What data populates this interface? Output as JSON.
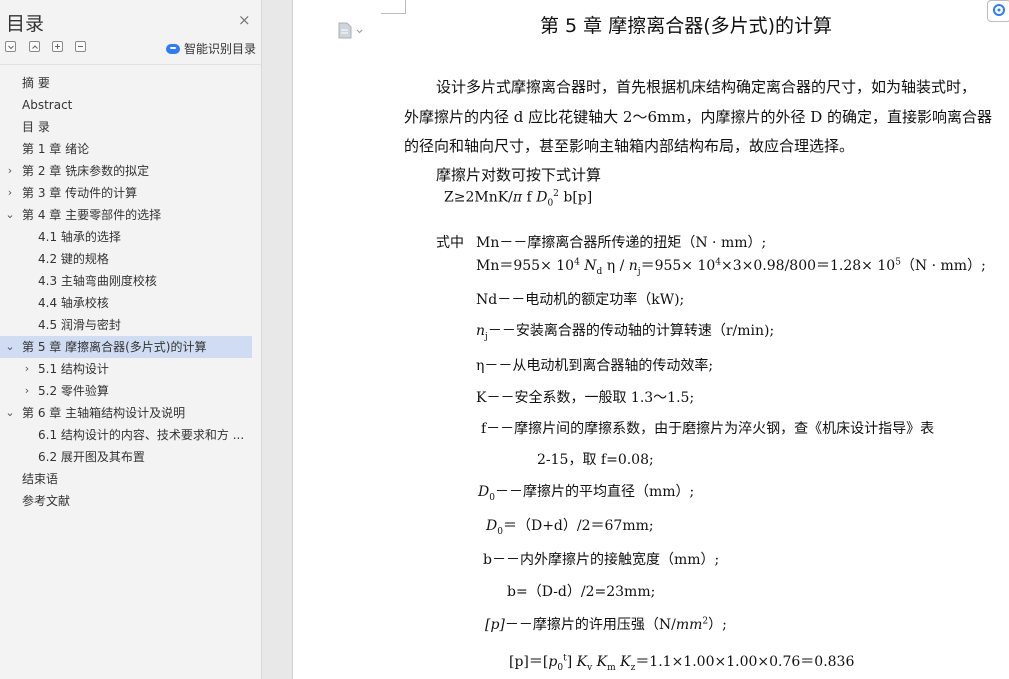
{
  "sidebar": {
    "title": "目录",
    "close_icon": "×",
    "smart_toc_label": "智能识别目录",
    "items": [
      {
        "label": "摘  要",
        "level": 1,
        "arrow": ""
      },
      {
        "label": "Abstract",
        "level": 1,
        "arrow": ""
      },
      {
        "label": "目  录",
        "level": 1,
        "arrow": ""
      },
      {
        "label": "第 1 章  绪论",
        "level": 1,
        "arrow": ""
      },
      {
        "label": "第 2 章  铣床参数的拟定",
        "level": 1,
        "arrow": "›"
      },
      {
        "label": "第 3 章  传动件的计算",
        "level": 1,
        "arrow": "›"
      },
      {
        "label": "第 4 章  主要零部件的选择",
        "level": 1,
        "arrow": "⌄"
      },
      {
        "label": "4.1  轴承的选择",
        "level": 2,
        "arrow": ""
      },
      {
        "label": "4.2  键的规格",
        "level": 2,
        "arrow": ""
      },
      {
        "label": "4.3  主轴弯曲刚度校核",
        "level": 2,
        "arrow": ""
      },
      {
        "label": "4.4  轴承校核",
        "level": 2,
        "arrow": ""
      },
      {
        "label": "4.5  润滑与密封",
        "level": 2,
        "arrow": ""
      },
      {
        "label": "第 5 章    摩擦离合器(多片式)的计算",
        "level": 1,
        "arrow": "⌄",
        "selected": true
      },
      {
        "label": "5.1  结构设计",
        "level": 2,
        "arrow": "›"
      },
      {
        "label": "5.2  零件验算",
        "level": 2,
        "arrow": "›"
      },
      {
        "label": "第 6 章  主轴箱结构设计及说明",
        "level": 1,
        "arrow": "⌄"
      },
      {
        "label": "6.1  结构设计的内容、技术要求和方 ...",
        "level": 2,
        "arrow": ""
      },
      {
        "label": "6.2  展开图及其布置",
        "level": 2,
        "arrow": ""
      },
      {
        "label": "结束语",
        "level": 1,
        "arrow": ""
      },
      {
        "label": "参考文献",
        "level": 1,
        "arrow": ""
      }
    ]
  },
  "document": {
    "chapter_title": "第 5 章    摩擦离合器(多片式)的计算",
    "para1_line1": "设计多片式摩擦离合器时，首先根据机床结构确定离合器的尺寸，如为轴装式时，",
    "para1_line2": "外摩擦片的内径 d 应比花键轴大 2～6mm，内摩擦片的外径 D 的确定，直接影响离合器",
    "para1_line3": "的径向和轴向尺寸，甚至影响主轴箱内部结构布局，故应合理选择。",
    "formula_intro": "摩擦片对数可按下式计算",
    "f_z_a": "Z≥2MnK/",
    "f_z_pi": "π",
    "f_z_b": " f ",
    "f_z_d": "D",
    "f_z_sub": "0",
    "f_z_sup": "2",
    "f_z_c": " b[p]",
    "where_label": "式中",
    "mn_def": "Mn－－摩擦离合器所传递的扭矩（N · mm）;",
    "mn_calc_a": "Mn＝955× 10",
    "mn_calc_sup1": "4",
    "mn_calc_nd": "N",
    "mn_calc_nd_sub": "d",
    "mn_calc_b": " η / ",
    "mn_calc_n": "n",
    "mn_calc_n_sub": "j",
    "mn_calc_c": "＝955× 10",
    "mn_calc_sup2": "4",
    "mn_calc_d": "×3×0.98/800＝1.28× 10",
    "mn_calc_sup3": "5",
    "mn_calc_e": "（N · mm）;",
    "nd_def": "Nd－－电动机的额定功率（kW);",
    "nj_var": "n",
    "nj_sub": "j",
    "nj_def": "－－安装离合器的传动轴的计算转速（r/min);",
    "eta_def": "η－－从电动机到离合器轴的传动效率;",
    "k_def": "K－－安全系数，一般取 1.3～1.5;",
    "f_def": "f－－摩擦片间的摩擦系数，由于磨擦片为淬火钢，查《机床设计指导》表",
    "f_def2": "2-15，取 f=0.08;",
    "d0_var": "D",
    "d0_sub": "0",
    "d0_def": "－－摩擦片的平均直径（mm）;",
    "d0_calc": "＝（D+d）/2＝67mm;",
    "b_def": "b－－内外摩擦片的接触宽度（mm）;",
    "b_calc": "b=（D-d）/2=23mm;",
    "p_var": "[p]",
    "p_def_a": "－－摩擦片的许用压强（N/",
    "p_def_mm": "mm",
    "p_def_sup": "2",
    "p_def_b": "）;",
    "p_calc_a": "[p]＝[",
    "p_calc_p0": "p",
    "p_calc_p0_sub": "0",
    "p_calc_p0_sup": "t",
    "p_calc_b": "] ",
    "p_calc_k": "K",
    "p_calc_kv": "v",
    "p_calc_km": "m",
    "p_calc_kz": "z",
    "p_calc_c": "＝1.1×1.00×1.00×0.76＝0.836"
  },
  "colors": {
    "selected_bg": "#cfdcf2",
    "accent": "#2e7cf6"
  }
}
